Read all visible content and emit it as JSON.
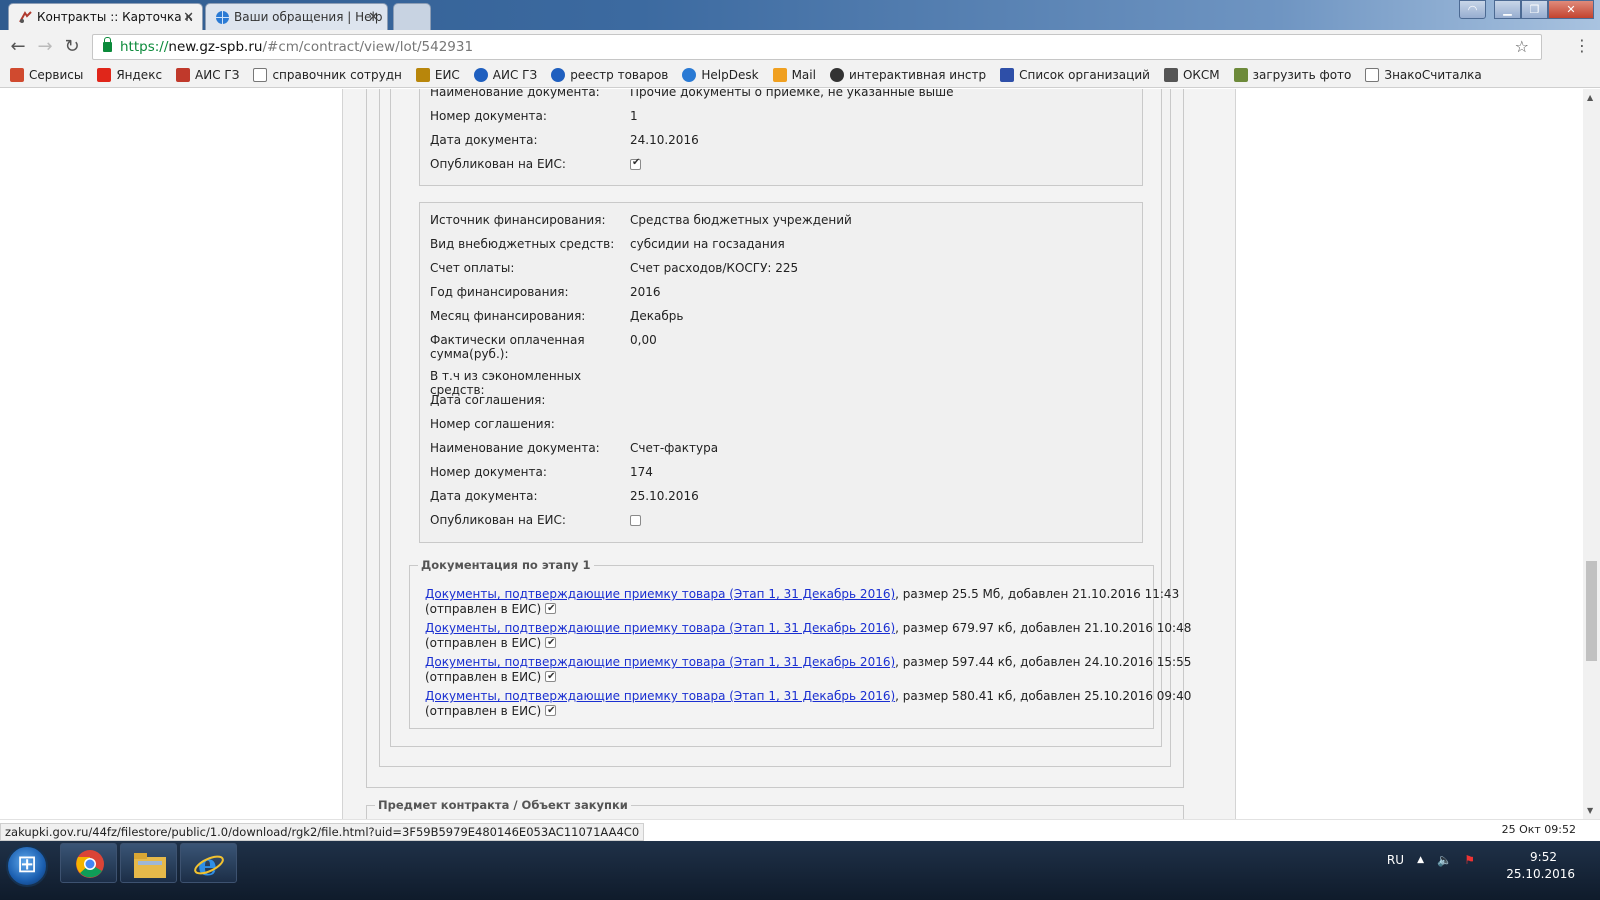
{
  "browser": {
    "tabs": [
      {
        "title": "Контракты :: Карточка к",
        "active": true
      },
      {
        "title": "Ваши обращения | Help",
        "active": false
      }
    ],
    "url": {
      "scheme": "https://",
      "host": "new.gz-spb.ru",
      "path": "/#cm/contract/view/lot/542931"
    },
    "bookmarks": [
      {
        "label": "Сервисы",
        "icon": "apps-grid-icon",
        "color": "#d04a2f"
      },
      {
        "label": "Яндекс",
        "icon": "yandex-icon",
        "color": "#e0261a"
      },
      {
        "label": "АИС ГЗ",
        "icon": "ais-icon",
        "color": "#c0392b"
      },
      {
        "label": "справочник сотрудн",
        "icon": "page-icon",
        "color": "#ffffff"
      },
      {
        "label": "ЕИС",
        "icon": "emblem-icon",
        "color": "#b8860b"
      },
      {
        "label": "АИС ГЗ",
        "icon": "globe-icon",
        "color": "#1f5fbf"
      },
      {
        "label": "реестр товаров",
        "icon": "globe-icon",
        "color": "#1f5fbf"
      },
      {
        "label": "HelpDesk",
        "icon": "helpdesk-icon",
        "color": "#2a7ad4"
      },
      {
        "label": "Mail",
        "icon": "mail-icon",
        "color": "#f0a020"
      },
      {
        "label": "интерактивная инстр",
        "icon": "c-icon",
        "color": "#333333"
      },
      {
        "label": "Список организаций",
        "icon": "org-icon",
        "color": "#2e4fa8"
      },
      {
        "label": "ОКСМ",
        "icon": "w-icon",
        "color": "#555555"
      },
      {
        "label": "загрузить фото",
        "icon": "photo-icon",
        "color": "#6d8a3a"
      },
      {
        "label": "ЗнакоСчиталка",
        "icon": "page-icon",
        "color": "#ffffff"
      }
    ]
  },
  "doc_block_top": {
    "rows": [
      {
        "label": "Наименование документа:",
        "value": "Прочие документы о приемке, не указанные выше"
      },
      {
        "label": "Номер документа:",
        "value": "1"
      },
      {
        "label": "Дата документа:",
        "value": "24.10.2016"
      },
      {
        "label": "Опубликован на ЕИС:",
        "checked": true
      }
    ]
  },
  "finance_block": {
    "rows": [
      {
        "label": "Источник финансирования:",
        "value": "Средства бюджетных учреждений"
      },
      {
        "label": "Вид внебюджетных средств:",
        "value": "субсидии на госзадания"
      },
      {
        "label": "Счет оплаты:",
        "value": "Счет расходов/КОСГУ: 225"
      },
      {
        "label": "Год финансирования:",
        "value": "2016"
      },
      {
        "label": "Месяц финансирования:",
        "value": "Декабрь"
      },
      {
        "label": "Фактически оплаченная сумма(руб.):",
        "value": "0,00"
      },
      {
        "label": "В т.ч из сэкономленных средств:",
        "value": ""
      },
      {
        "label": "Дата соглашения:",
        "value": ""
      },
      {
        "label": "Номер соглашения:",
        "value": ""
      },
      {
        "label": "Наименование документа:",
        "value": "Счет-фактура"
      },
      {
        "label": "Номер документа:",
        "value": "174"
      },
      {
        "label": "Дата документа:",
        "value": "25.10.2016"
      },
      {
        "label": "Опубликован на ЕИС:",
        "checked": false
      }
    ]
  },
  "stage_docs": {
    "legend": "Документация по этапу 1",
    "files": [
      {
        "link": "Документы, подтверждающие приемку товара (Этап 1, 31 Декабрь 2016)",
        "info": ", размер 25.5 Мб, добавлен 21.10.2016 11:43",
        "sent": "(отправлен в ЕИС)"
      },
      {
        "link": "Документы, подтверждающие приемку товара (Этап 1, 31 Декабрь 2016)",
        "info": ", размер 679.97 кб, добавлен 21.10.2016 10:48",
        "sent": "(отправлен в ЕИС)"
      },
      {
        "link": "Документы, подтверждающие приемку товара (Этап 1, 31 Декабрь 2016)",
        "info": ", размер 597.44 кб, добавлен 24.10.2016 15:55",
        "sent": "(отправлен в ЕИС)"
      },
      {
        "link": "Документы, подтверждающие приемку товара (Этап 1, 31 Декабрь 2016)",
        "info": ", размер 580.41 кб, добавлен 25.10.2016 09:40",
        "sent": "(отправлен в ЕИС)"
      }
    ]
  },
  "next_section": {
    "legend": "Предмет контракта / Объект закупки"
  },
  "status": {
    "hover_url": "zakupki.gov.ru/44fz/filestore/public/1.0/download/rgk2/file.html?uid=3F59B5979E480146E053AC11071AA4C0",
    "page_date": "25 Окт 09:52"
  },
  "taskbar": {
    "lang": "RU",
    "time": "9:52",
    "date": "25.10.2016"
  }
}
